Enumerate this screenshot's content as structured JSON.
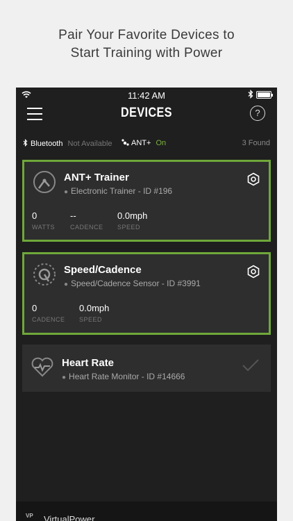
{
  "promo": {
    "line1": "Pair Your Favorite Devices to",
    "line2": "Start Training with Power"
  },
  "status": {
    "time": "11:42 AM"
  },
  "nav": {
    "title": "DEVICES",
    "help": "?"
  },
  "connections": {
    "bluetooth_label": "Bluetooth",
    "bluetooth_state": "Not Available",
    "ant_label": "ANT+",
    "ant_state": "On",
    "found": "3 Found"
  },
  "devices": [
    {
      "title": "ANT+ Trainer",
      "subtitle": "Electronic Trainer - ID #196",
      "active": true,
      "metrics": [
        {
          "value": "0",
          "label": "WATTS"
        },
        {
          "value": "--",
          "label": "CADENCE"
        },
        {
          "value": "0.0mph",
          "label": "SPEED"
        }
      ]
    },
    {
      "title": "Speed/Cadence",
      "subtitle": "Speed/Cadence Sensor - ID #3991",
      "active": true,
      "metrics": [
        {
          "value": "0",
          "label": "CADENCE"
        },
        {
          "value": "0.0mph",
          "label": "SPEED"
        }
      ]
    },
    {
      "title": "Heart Rate",
      "subtitle": "Heart Rate Monitor - ID #14666",
      "active": false
    }
  ],
  "bottom": {
    "logo": "VP",
    "label": "VirtualPower"
  },
  "colors": {
    "accent": "#6fa83a",
    "active_text": "#7cb342",
    "background": "#1f1f1f",
    "card": "#2e2e2e"
  }
}
